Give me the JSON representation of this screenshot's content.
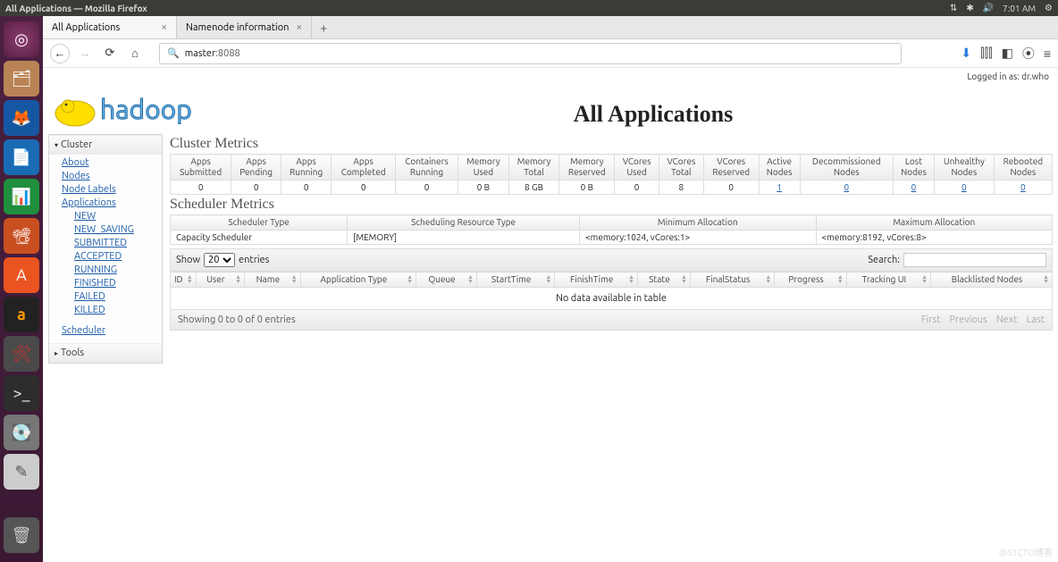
{
  "os": {
    "window_title": "All Applications — Mozilla Firefox",
    "time": "7:01 AM"
  },
  "browser": {
    "tabs": [
      {
        "label": "All Applications",
        "active": true
      },
      {
        "label": "Namenode information",
        "active": false
      }
    ],
    "url_host": "master",
    "url_port": ":8088"
  },
  "hadoop": {
    "login": "Logged in as: dr.who",
    "page_title": "All Applications",
    "sidebar": {
      "cluster": "Cluster",
      "links": [
        "About",
        "Nodes",
        "Node Labels",
        "Applications"
      ],
      "app_states": [
        "NEW",
        "NEW_SAVING",
        "SUBMITTED",
        "ACCEPTED",
        "RUNNING",
        "FINISHED",
        "FAILED",
        "KILLED"
      ],
      "scheduler": "Scheduler",
      "tools": "Tools"
    },
    "cluster_metrics": {
      "title": "Cluster Metrics",
      "headers": [
        "Apps Submitted",
        "Apps Pending",
        "Apps Running",
        "Apps Completed",
        "Containers Running",
        "Memory Used",
        "Memory Total",
        "Memory Reserved",
        "VCores Used",
        "VCores Total",
        "VCores Reserved",
        "Active Nodes",
        "Decommissioned Nodes",
        "Lost Nodes",
        "Unhealthy Nodes",
        "Rebooted Nodes"
      ],
      "values": [
        "0",
        "0",
        "0",
        "0",
        "0",
        "0 B",
        "8 GB",
        "0 B",
        "0",
        "8",
        "0",
        "1",
        "0",
        "0",
        "0",
        "0"
      ],
      "link_cols": [
        11,
        12,
        13,
        14,
        15
      ]
    },
    "scheduler_metrics": {
      "title": "Scheduler Metrics",
      "headers": [
        "Scheduler Type",
        "Scheduling Resource Type",
        "Minimum Allocation",
        "Maximum Allocation"
      ],
      "values": [
        "Capacity Scheduler",
        "[MEMORY]",
        "<memory:1024, vCores:1>",
        "<memory:8192, vCores:8>"
      ]
    },
    "apps": {
      "show": "Show",
      "entries": "entries",
      "page_size": "20",
      "search_label": "Search:",
      "headers": [
        "ID",
        "User",
        "Name",
        "Application Type",
        "Queue",
        "StartTime",
        "FinishTime",
        "State",
        "FinalStatus",
        "Progress",
        "Tracking UI",
        "Blacklisted Nodes"
      ],
      "no_data": "No data available in table",
      "info": "Showing 0 to 0 of 0 entries",
      "pager": [
        "First",
        "Previous",
        "Next",
        "Last"
      ]
    }
  },
  "watermark": "@51CTO博客"
}
